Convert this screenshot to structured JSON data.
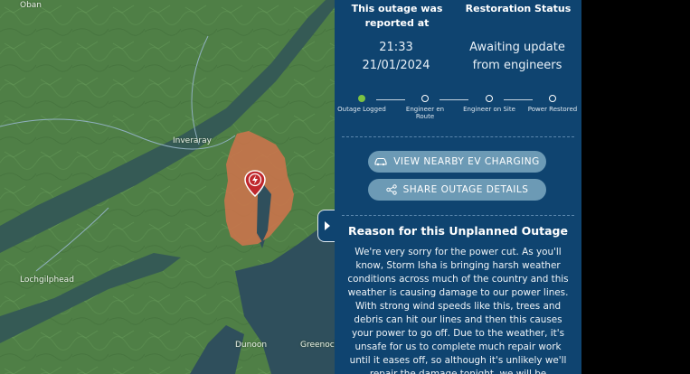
{
  "map": {
    "places": [
      "Oban",
      "Inveraray",
      "Lochgilphead",
      "Dunoon",
      "Greenock"
    ]
  },
  "status": {
    "reported_heading": "This outage was reported at",
    "restoration_heading": "Restoration Status",
    "time": "21:33",
    "date": "21/01/2024",
    "restoration_value": "Awaiting update from engineers"
  },
  "steps": [
    {
      "label": "Outage Logged",
      "done": true
    },
    {
      "label": "Engineer en Route",
      "done": false
    },
    {
      "label": "Engineer on Site",
      "done": false
    },
    {
      "label": "Power Restored",
      "done": false
    }
  ],
  "actions": {
    "ev_label": "VIEW NEARBY EV CHARGING",
    "share_label": "SHARE OUTAGE DETAILS"
  },
  "reason": {
    "title": "Reason for this Unplanned Outage",
    "body": "We're very sorry for the power cut. As you'll know, Storm Isha is bringing harsh weather conditions across much of the country and this weather is causing damage to our power lines. With strong wind speeds like this, trees and debris can hit our lines and then this causes your power to go off. Due to the weather, it's unsafe for us to complete much repair work until it eases off, so although it's unlikely we'll repair the damage tonight, we will be"
  },
  "colors": {
    "panel": "#0f4470",
    "land": "#4f7f46",
    "water": "#2f4f5c",
    "outage_area": "#c9744b",
    "pin": "#c0272d",
    "step_done": "#7cc242"
  },
  "icons": {
    "ev": "car-icon",
    "share": "share-icon",
    "pin": "lightning-pin-icon",
    "toggle": "chevron-right-icon"
  }
}
